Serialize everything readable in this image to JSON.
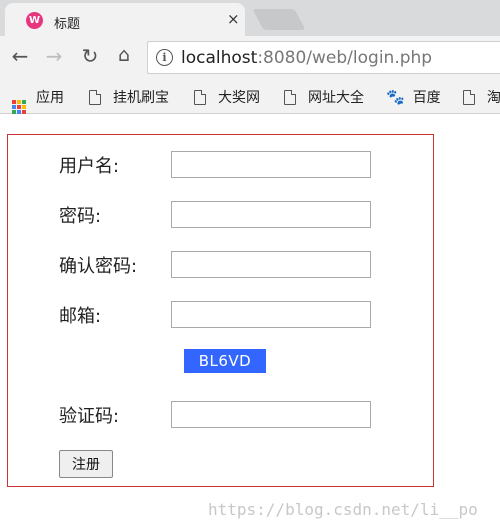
{
  "browser": {
    "tab_title": "标题",
    "tab_close": "×",
    "url_host": "localhost",
    "url_rest": ":8080/web/login.php"
  },
  "bookmarks": [
    {
      "label": "应用",
      "icon": "apps-icon"
    },
    {
      "label": "挂机刷宝",
      "icon": "page-icon"
    },
    {
      "label": "大奖网",
      "icon": "page-icon"
    },
    {
      "label": "网址大全",
      "icon": "page-icon"
    },
    {
      "label": "百度",
      "icon": "baidu-paw-icon"
    },
    {
      "label": "淘",
      "icon": "page-icon"
    }
  ],
  "form": {
    "username_label": "用户名:",
    "password_label": "密码:",
    "confirm_label": "确认密码:",
    "email_label": "邮箱:",
    "captcha_text": "BL6VD",
    "captcha_label": "验证码:",
    "submit_label": "注册",
    "username_value": "",
    "password_value": "",
    "confirm_value": "",
    "email_value": "",
    "captcha_value": ""
  },
  "colors": {
    "form_border": "#cc3333",
    "captcha_bg": "#3366ff",
    "favicon": "#e8367e"
  },
  "watermark": "https://blog.csdn.net/li__po"
}
